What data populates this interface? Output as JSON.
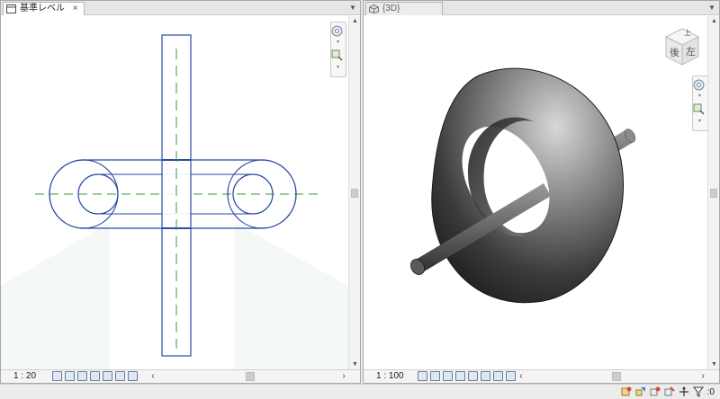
{
  "left_view": {
    "tab_title": "基準レベル",
    "tab_close": "×",
    "scale": "1 : 20",
    "view_type": "floor-plan"
  },
  "right_view": {
    "tab_title": "{3D}",
    "scale": "1 : 100",
    "view_type": "3d",
    "viewcube": {
      "top_label": "上",
      "back_label": "後",
      "left_label": "左"
    }
  },
  "scroll": {
    "left_arrow": "‹",
    "right_arrow": "›",
    "up_arrow": "▲",
    "down_arrow": "▼"
  },
  "status_bar": {
    "filter_count": ":0"
  },
  "colors": {
    "plan_lines": "#2b4aa6",
    "centerline": "#3a9a3a",
    "torus_dark": "#2b2b2b",
    "torus_light": "#bdbdbd",
    "canvas_bg": "#ffffff",
    "pane_border": "#a9a9a9"
  },
  "icons": {
    "tab_left": "floor-plan-icon",
    "tab_right": "3d-view-icon",
    "navbar": [
      "steering-wheel-icon",
      "zoom-icon"
    ],
    "status": [
      "worksets-icon",
      "design-options-icon",
      "selection-links-icon",
      "selection-pinned-icon",
      "drag-elements-icon",
      "filter-icon"
    ]
  }
}
